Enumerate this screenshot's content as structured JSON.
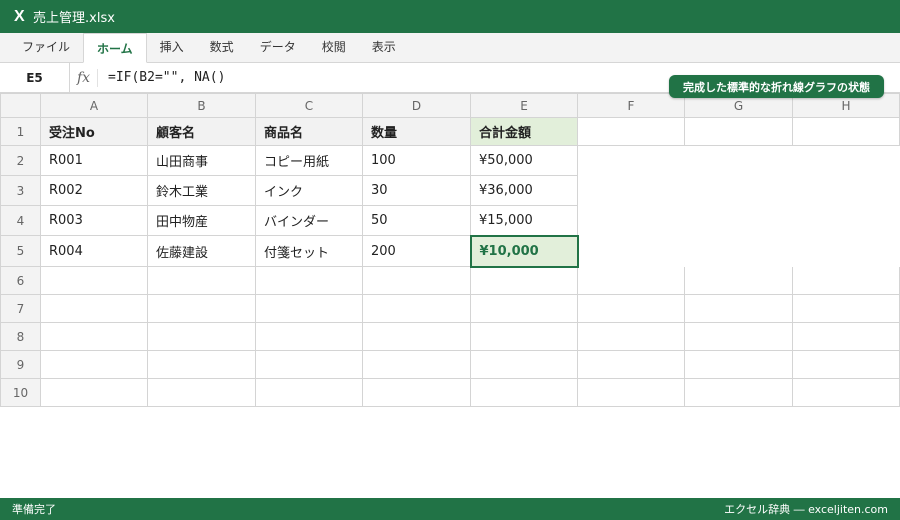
{
  "window": {
    "icon": "excel-x-icon",
    "logo_text": "X",
    "title": "売上管理.xlsx"
  },
  "ribbon": {
    "tabs": [
      "ファイル",
      "ホーム",
      "挿入",
      "数式",
      "データ",
      "校閲",
      "表示"
    ],
    "active_tab": "ホーム"
  },
  "formula_bar": {
    "name_box": "E5",
    "fx_label": "fx",
    "formula": "=IF(B2=\"\", NA()"
  },
  "badge": {
    "text": "完成した標準的な折れ線グラフの状態"
  },
  "grid": {
    "columns": [
      "A",
      "B",
      "C",
      "D",
      "E",
      "F",
      "G",
      "H"
    ],
    "rows": [
      {
        "num": "1",
        "cells": [
          "受注No",
          "顧客名",
          "商品名",
          "数量",
          "合計金額",
          "",
          "",
          ""
        ]
      },
      {
        "num": "2",
        "cells": [
          "R001",
          "山田商事",
          "コピー用紙",
          "100",
          "¥50,000",
          "",
          "",
          ""
        ]
      },
      {
        "num": "3",
        "cells": [
          "R002",
          "鈴木工業",
          "インク",
          "30",
          "¥36,000",
          "",
          "",
          ""
        ]
      },
      {
        "num": "4",
        "cells": [
          "R003",
          "田中物産",
          "バインダー",
          "50",
          "¥15,000",
          "",
          "",
          ""
        ]
      },
      {
        "num": "5",
        "cells": [
          "R004",
          "佐藤建設",
          "付箋セット",
          "200",
          "¥10,000",
          "",
          "",
          ""
        ]
      },
      {
        "num": "6",
        "cells": [
          "",
          "",
          "",
          "",
          "",
          "",
          "",
          ""
        ]
      },
      {
        "num": "7",
        "cells": [
          "",
          "",
          "",
          "",
          "",
          "",
          "",
          ""
        ]
      },
      {
        "num": "8",
        "cells": [
          "",
          "",
          "",
          "",
          "",
          "",
          "",
          ""
        ]
      },
      {
        "num": "9",
        "cells": [
          "",
          "",
          "",
          "",
          "",
          "",
          "",
          ""
        ]
      },
      {
        "num": "10",
        "cells": [
          "",
          "",
          "",
          "",
          "",
          "",
          "",
          ""
        ]
      }
    ],
    "selected_cell": "E5"
  },
  "status_bar": {
    "left": "準備完了",
    "right": "エクセル辞典 ― exceljiten.com"
  },
  "colors": {
    "accent": "#217346",
    "highlight": "#e2efda",
    "header_gray": "#f3f3f3"
  }
}
